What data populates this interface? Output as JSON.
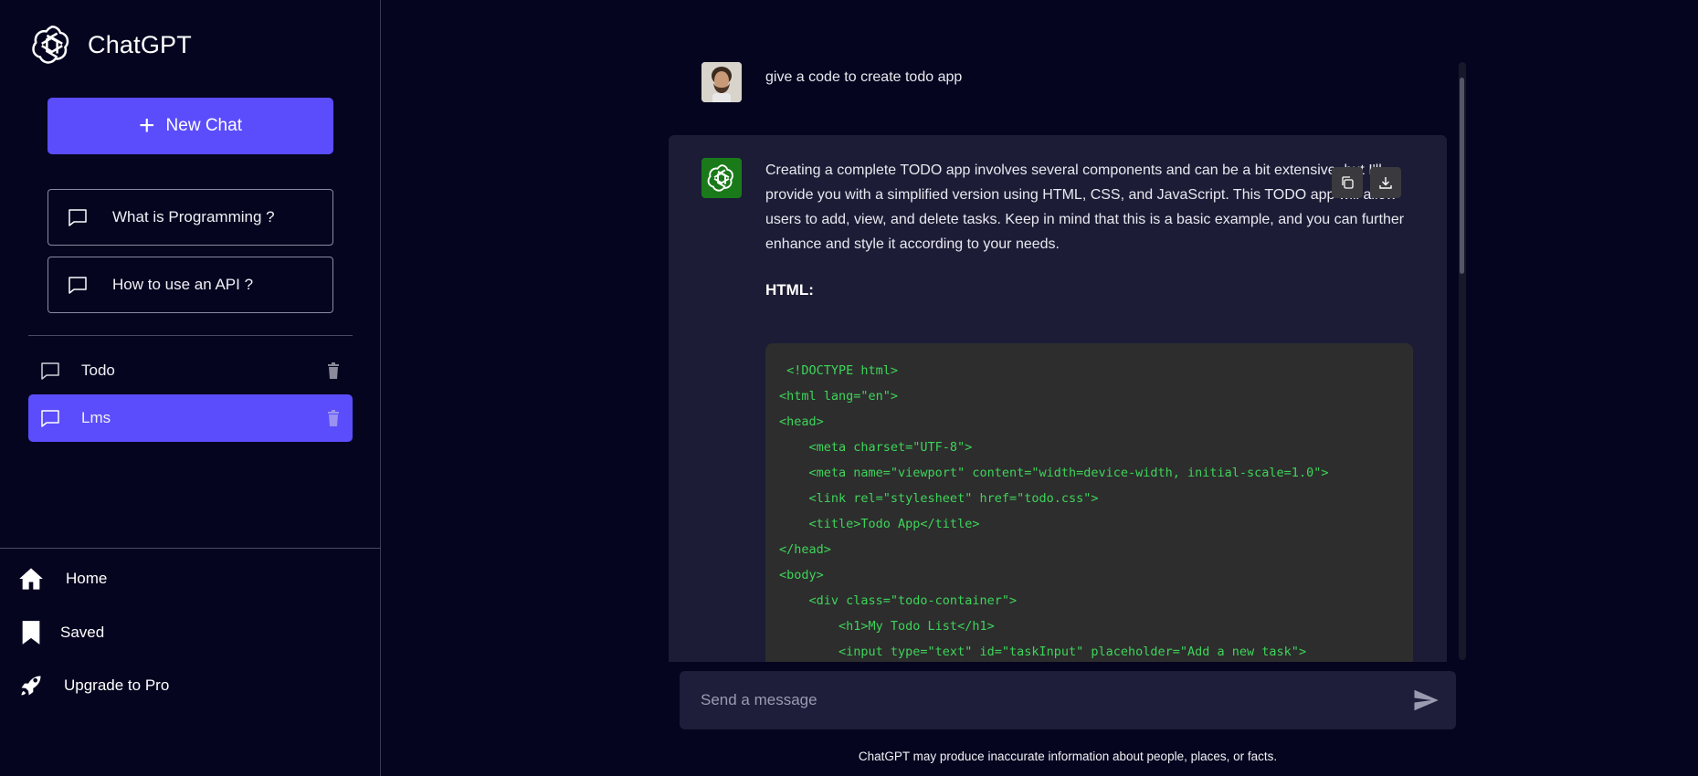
{
  "sidebar": {
    "brand": "ChatGPT",
    "new_chat_label": "New Chat",
    "suggestions": [
      {
        "label": "What is Programming ?"
      },
      {
        "label": "How to use an API ?"
      }
    ],
    "history": [
      {
        "label": "Todo",
        "active": false
      },
      {
        "label": "Lms",
        "active": true
      }
    ],
    "nav": [
      {
        "label": "Home",
        "icon": "home-icon"
      },
      {
        "label": "Saved",
        "icon": "bookmark-icon"
      },
      {
        "label": "Upgrade to Pro",
        "icon": "rocket-icon"
      }
    ]
  },
  "chat": {
    "user_message": "give a code to create todo app",
    "bot_message": "Creating a complete TODO app involves several components and can be a bit extensive, but I'll provide you with a simplified version using HTML, CSS, and JavaScript. This TODO app will allow users to add, view, and delete tasks. Keep in mind that this is a basic example, and you can further enhance and style it according to your needs.",
    "bot_heading": "HTML:",
    "code_lines": [
      " <!DOCTYPE html>",
      "<html lang=\"en\">",
      "<head>",
      "    <meta charset=\"UTF-8\">",
      "    <meta name=\"viewport\" content=\"width=device-width, initial-scale=1.0\">",
      "    <link rel=\"stylesheet\" href=\"todo.css\">",
      "    <title>Todo App</title>",
      "</head>",
      "<body>",
      "    <div class=\"todo-container\">",
      "        <h1>My Todo List</h1>",
      "        <input type=\"text\" id=\"taskInput\" placeholder=\"Add a new task\">"
    ]
  },
  "composer": {
    "placeholder": "Send a message",
    "disclaimer": "ChatGPT may produce inaccurate information about people, places, or facts."
  },
  "colors": {
    "accent": "#5b4dfb",
    "background": "#050520",
    "code_text": "#3ed45a",
    "bot_bubble": "#1c1c36"
  }
}
